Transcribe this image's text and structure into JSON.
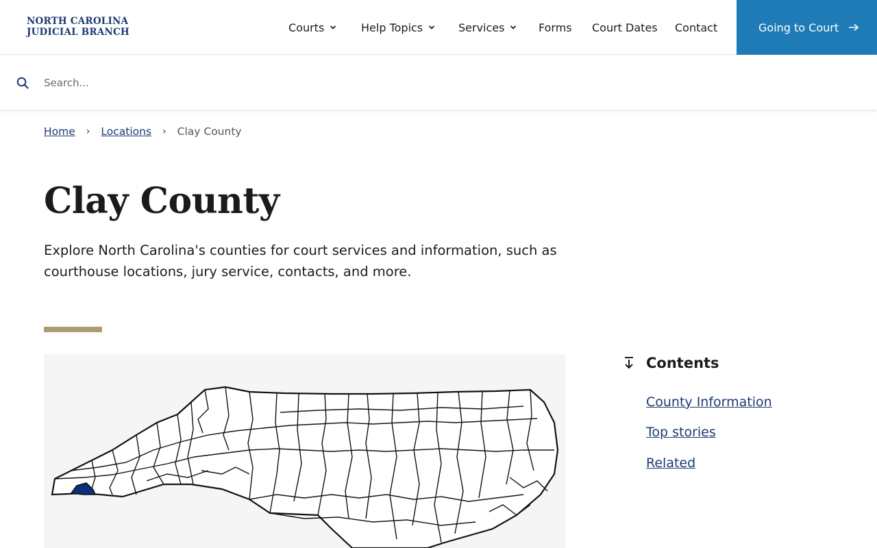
{
  "header": {
    "logo_line1": "NORTH CAROLINA",
    "logo_line2": "JUDICIAL BRANCH",
    "nav": {
      "courts": "Courts",
      "help_topics": "Help Topics",
      "services": "Services",
      "forms": "Forms",
      "court_dates": "Court Dates",
      "contact": "Contact"
    },
    "cta_label": "Going to Court"
  },
  "search": {
    "placeholder": "Search..."
  },
  "breadcrumb": {
    "home": "Home",
    "locations": "Locations",
    "current": "Clay County"
  },
  "page": {
    "title": "Clay County",
    "intro": "Explore North Carolina's counties for court services and information, such as courthouse locations, jury service, contacts, and more."
  },
  "contents": {
    "heading": "Contents",
    "links": [
      "County Information",
      "Top stories",
      "Related"
    ]
  },
  "colors": {
    "brand": "#1c3a70",
    "cta": "#1f7bb6",
    "accent": "#ad9b74",
    "highlight_county": "#0b2f7a"
  },
  "icons": {
    "search": "search-icon",
    "chevron": "chevron-down-icon",
    "arrow": "arrow-right-icon",
    "contents": "arrow-down-icon"
  }
}
